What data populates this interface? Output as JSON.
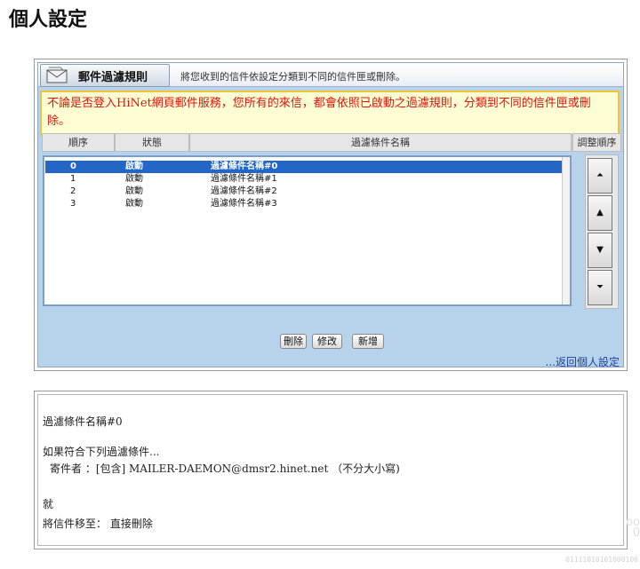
{
  "page": {
    "title": "個人設定"
  },
  "panel": {
    "header_title": "郵件過濾規則",
    "header_desc": "將您收到的信件依設定分類到不同的信件匣或刪除。",
    "warning": "不論是否登入HiNet網頁郵件服務，您所有的來信，都會依照已啟動之過濾規則，分類到不同的信件匣或刪除。",
    "columns": {
      "order": "順序",
      "status": "狀態",
      "name": "過濾條件名稱",
      "adjust": "調整順序"
    },
    "rules": [
      {
        "order": "0",
        "status": "啟動",
        "name": "過濾條件名稱#0",
        "selected": true
      },
      {
        "order": "1",
        "status": "啟動",
        "name": "過濾條件名稱#1",
        "selected": false
      },
      {
        "order": "2",
        "status": "啟動",
        "name": "過濾條件名稱#2",
        "selected": false
      },
      {
        "order": "3",
        "status": "啟動",
        "name": "過濾條件名稱#3",
        "selected": false
      }
    ],
    "move_buttons": {
      "top": "⏶",
      "up": "▲",
      "down": "▼",
      "bottom": "⏷"
    },
    "buttons": {
      "delete": "刪除",
      "edit": "修改",
      "add": "新增"
    },
    "back_link": "...返回個人設定"
  },
  "detail": {
    "rule_name": "過濾條件名稱#0",
    "condition_intro": "如果符合下列過濾條件...",
    "condition": "寄件者 ：[包含] MAILER-DAEMON@dmsr2.hinet.net （不分大小寫)",
    "then_label": "就",
    "action": "將信件移至： 直接刪除"
  },
  "watermark": {
    "side_text": "oo\n0",
    "bottom_text": "01111010101000100"
  },
  "colors": {
    "selected_row": "#2366c6",
    "panel_bg": "#b7d3ec",
    "warning_text": "#e3120b",
    "warning_bg": "#fffdd3"
  },
  "icons": {
    "header": "mail-envelope-icon"
  }
}
